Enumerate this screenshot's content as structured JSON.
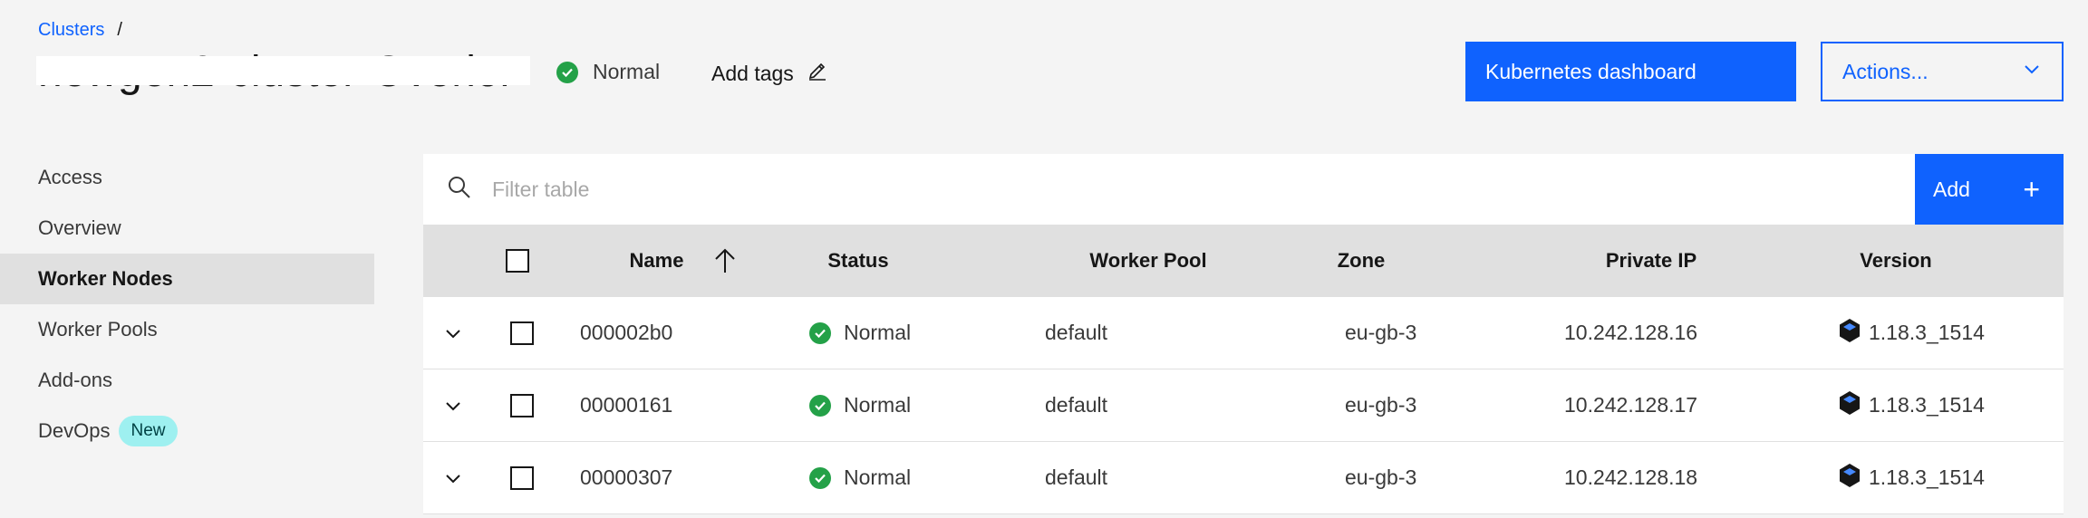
{
  "breadcrumb": {
    "link": "Clusters",
    "separator": "/"
  },
  "header": {
    "title": "newgen2-cluster-Overlor",
    "status": "Normal",
    "tags_label": "Add tags",
    "k8s_button": "Kubernetes dashboard",
    "actions_button": "Actions..."
  },
  "sidebar": {
    "items": [
      {
        "label": "Access"
      },
      {
        "label": "Overview"
      },
      {
        "label": "Worker Nodes",
        "active": true
      },
      {
        "label": "Worker Pools"
      },
      {
        "label": "Add-ons"
      },
      {
        "label": "DevOps",
        "badge": "New"
      }
    ]
  },
  "table": {
    "search_placeholder": "Filter table",
    "add_label": "Add",
    "add_icon": "+",
    "columns": {
      "name": "Name",
      "status": "Status",
      "pool": "Worker Pool",
      "zone": "Zone",
      "ip": "Private IP",
      "version": "Version"
    },
    "rows": [
      {
        "name": "000002b0",
        "status": "Normal",
        "pool": "default",
        "zone": "eu-gb-3",
        "ip": "10.242.128.16",
        "version": "1.18.3_1514"
      },
      {
        "name": "00000161",
        "status": "Normal",
        "pool": "default",
        "zone": "eu-gb-3",
        "ip": "10.242.128.17",
        "version": "1.18.3_1514"
      },
      {
        "name": "00000307",
        "status": "Normal",
        "pool": "default",
        "zone": "eu-gb-3",
        "ip": "10.242.128.18",
        "version": "1.18.3_1514"
      }
    ]
  },
  "colors": {
    "accent": "#0f62fe",
    "success": "#24a148",
    "badge": "#9ef0f0"
  }
}
